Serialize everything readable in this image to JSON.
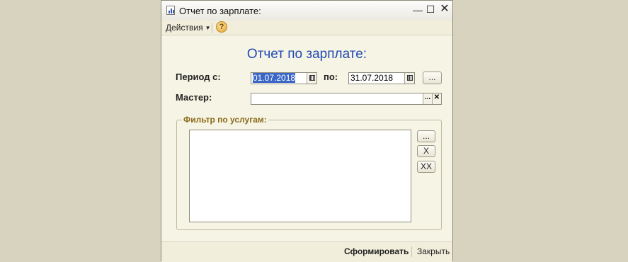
{
  "window": {
    "title": "Отчет по зарплате:",
    "icon": "report-icon"
  },
  "toolbar": {
    "actions_label": "Действия",
    "help_label": "?"
  },
  "form": {
    "title": "Отчет по зарплате:",
    "period_from_label": "Период с:",
    "period_from_value": "01.07.2018",
    "period_to_label": "по:",
    "period_to_value": "31.07.2018",
    "period_button": "...",
    "master_label": "Мастер:",
    "master_value": "",
    "master_select_button": "...",
    "master_clear_button": "✕"
  },
  "filter": {
    "label": "Фильтр по услугам:",
    "items": [],
    "add_button": "...",
    "remove_button": "X",
    "clear_button": "XX"
  },
  "footer": {
    "generate_label": "Сформировать",
    "close_label": "Закрыть"
  },
  "colors": {
    "title_blue": "#2049b5",
    "group_label": "#8a6a1c",
    "selection": "#3a66c8"
  }
}
